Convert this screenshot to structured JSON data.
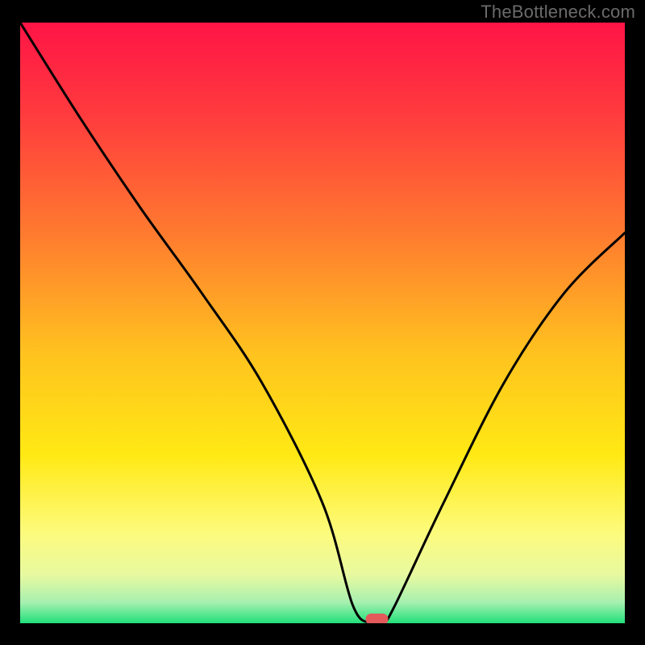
{
  "attribution": "TheBottleneck.com",
  "chart_data": {
    "type": "line",
    "title": "",
    "xlabel": "",
    "ylabel": "",
    "xlim": [
      0,
      100
    ],
    "ylim": [
      0,
      100
    ],
    "grid": false,
    "series": [
      {
        "name": "bottleneck-curve",
        "x": [
          0,
          10,
          20,
          30,
          40,
          50,
          55,
          58,
          60,
          62,
          70,
          80,
          90,
          100
        ],
        "values": [
          100,
          84,
          69,
          55,
          40,
          20,
          3,
          0,
          0,
          3,
          20,
          40,
          55,
          65
        ]
      }
    ],
    "marker": {
      "x": 59,
      "y": 0
    },
    "gradient_stops": [
      {
        "offset": 0.0,
        "color": "#ff1446"
      },
      {
        "offset": 0.15,
        "color": "#ff3a3e"
      },
      {
        "offset": 0.35,
        "color": "#ff7a2f"
      },
      {
        "offset": 0.55,
        "color": "#ffc21f"
      },
      {
        "offset": 0.72,
        "color": "#ffe914"
      },
      {
        "offset": 0.85,
        "color": "#fdfb7d"
      },
      {
        "offset": 0.92,
        "color": "#e7f9a0"
      },
      {
        "offset": 0.965,
        "color": "#a7f0b0"
      },
      {
        "offset": 1.0,
        "color": "#21e07a"
      }
    ]
  }
}
